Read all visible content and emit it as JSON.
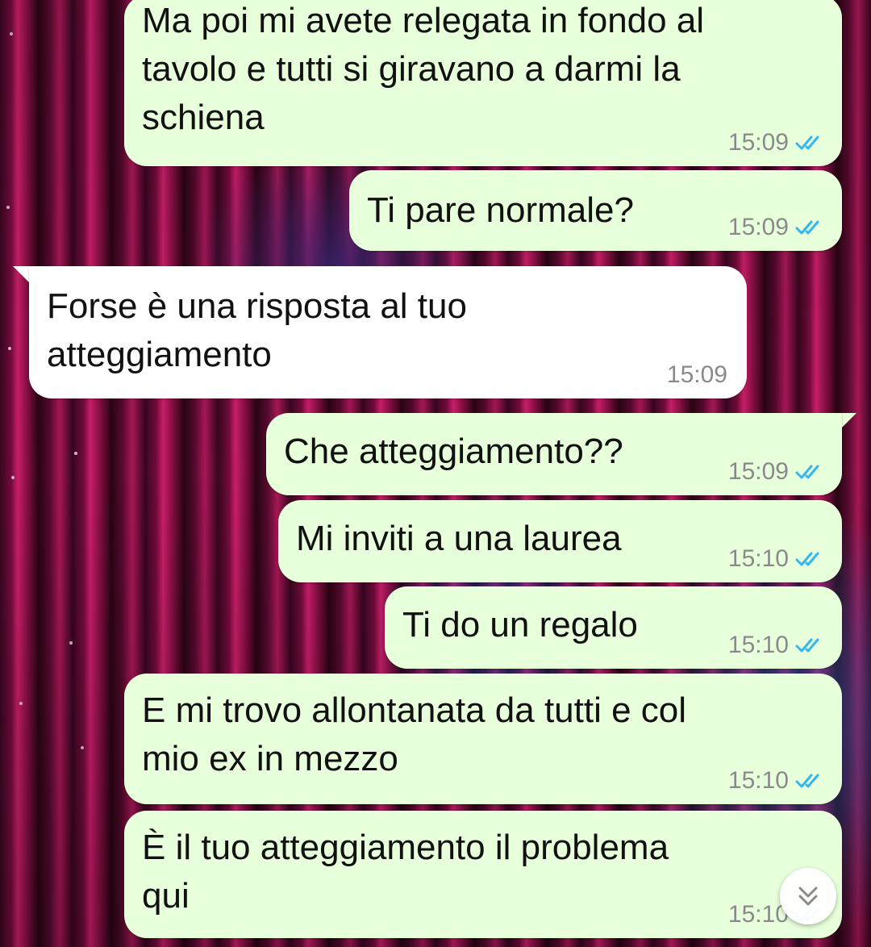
{
  "messages": [
    {
      "direction": "outgoing",
      "text": "Ma poi mi avete relegata in fondo al\ntavolo e tutti si giravano a darmi la\nschiena",
      "time": "15:09",
      "status": "read"
    },
    {
      "direction": "outgoing",
      "text": "Ti pare normale?",
      "time": "15:09",
      "status": "read"
    },
    {
      "direction": "incoming",
      "text": "Forse è una risposta al tuo\natteggiamento",
      "time": "15:09"
    },
    {
      "direction": "outgoing",
      "text": "Che atteggiamento??",
      "time": "15:09",
      "status": "read"
    },
    {
      "direction": "outgoing",
      "text": "Mi inviti a una laurea",
      "time": "15:10",
      "status": "read"
    },
    {
      "direction": "outgoing",
      "text": "Ti do un regalo",
      "time": "15:10",
      "status": "read"
    },
    {
      "direction": "outgoing",
      "text": "E mi trovo allontanata da tutti e col\nmio ex in mezzo",
      "time": "15:10",
      "status": "read"
    },
    {
      "direction": "outgoing",
      "text": "È il tuo atteggiamento il problema\nqui",
      "time": "15:10",
      "status": "read"
    }
  ],
  "colors": {
    "outgoing_bubble": "#e7ffdb",
    "incoming_bubble": "#ffffff",
    "read_ticks": "#34b7f1",
    "timestamp": "#8a8a8a"
  },
  "icons": {
    "read_receipt": "double-check-icon",
    "scroll_down": "double-chevron-down-icon"
  }
}
